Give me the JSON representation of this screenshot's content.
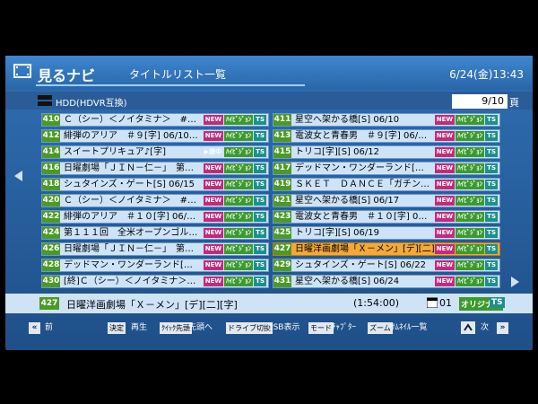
{
  "header": {
    "app_name": "見るナビ",
    "screen_title": "タイトルリスト一覧",
    "datetime": "6/24(金)13:43"
  },
  "drive": {
    "label": "HDD(HDVR互換)",
    "page_current": "9/10",
    "page_unit": "頁"
  },
  "badges": {
    "new": "NEW",
    "hd": "ﾊｲﾋﾞｼﾞｮﾝ",
    "ts": "TS",
    "playing": "▶途中"
  },
  "items": [
    {
      "num": "410",
      "title": "Ｃ（シー）＜ノイタミナ＞　#…",
      "badges": [
        "new",
        "hd",
        "ts"
      ]
    },
    {
      "num": "411",
      "title": "星空へ架かる橋[S] 06/10",
      "badges": [
        "new",
        "hd",
        "ts"
      ]
    },
    {
      "num": "412",
      "title": "緋弾のアリア　＃９[字] 06/10…",
      "badges": [
        "new",
        "hd",
        "ts"
      ]
    },
    {
      "num": "413",
      "title": "電波女と青春男　＃９[字] 06/…",
      "badges": [
        "new",
        "hd",
        "ts"
      ]
    },
    {
      "num": "414",
      "title": "スイートプリキュア♪[字]",
      "badges": [
        "playing",
        "hd",
        "ts"
      ]
    },
    {
      "num": "415",
      "title": "トリコ[字][S] 06/12",
      "badges": [
        "new",
        "hd",
        "ts"
      ]
    },
    {
      "num": "416",
      "title": "日曜劇場「ＪＩＮ－仁－」　第…",
      "badges": [
        "new",
        "hd",
        "ts"
      ]
    },
    {
      "num": "417",
      "title": "デッドマン・ワンダーランド[…",
      "badges": [
        "new",
        "hd",
        "ts"
      ]
    },
    {
      "num": "418",
      "title": "シュタインズ・ゲート[S] 06/15",
      "badges": [
        "new",
        "hd",
        "ts"
      ]
    },
    {
      "num": "419",
      "title": "ＳＫＥＴ　ＤＡＮＣＥ「ガチン…",
      "badges": [
        "new",
        "hd",
        "ts"
      ]
    },
    {
      "num": "420",
      "title": "Ｃ（シー）＜ノイタミナ＞　#…",
      "badges": [
        "new",
        "hd",
        "ts"
      ]
    },
    {
      "num": "421",
      "title": "星空へ架かる橋[S] 06/17",
      "badges": [
        "new",
        "hd",
        "ts"
      ]
    },
    {
      "num": "422",
      "title": "緋弾のアリア　＃１０[字] 06/…",
      "badges": [
        "new",
        "hd",
        "ts"
      ]
    },
    {
      "num": "423",
      "title": "電波女と青春男　＃１０[字] 0…",
      "badges": [
        "new",
        "hd",
        "ts"
      ]
    },
    {
      "num": "424",
      "title": "第１１１回　全米オープンゴル…",
      "badges": [
        "new",
        "hd",
        "ts"
      ]
    },
    {
      "num": "425",
      "title": "トリコ[字][S] 06/19",
      "badges": [
        "new",
        "hd",
        "ts"
      ]
    },
    {
      "num": "426",
      "title": "日曜劇場「ＪＩＮ－仁－」　第…",
      "badges": [
        "new",
        "hd",
        "ts"
      ]
    },
    {
      "num": "427",
      "title": "日曜洋画劇場「Ｘ－メン」[デ][二]…",
      "badges": [
        "new",
        "hd",
        "ts"
      ],
      "selected": true
    },
    {
      "num": "428",
      "title": "デッドマン・ワンダーランド[…",
      "badges": [
        "new",
        "hd",
        "ts"
      ]
    },
    {
      "num": "429",
      "title": "シュタインズ・ゲート[S] 06/22",
      "badges": [
        "new",
        "hd",
        "ts"
      ]
    },
    {
      "num": "430",
      "title": "[終]Ｃ（シー）＜ノイタミナ＞…",
      "badges": [
        "new",
        "hd",
        "ts"
      ]
    },
    {
      "num": "431",
      "title": "星空へ架かる橋[S] 06/24",
      "badges": [
        "new",
        "hd",
        "ts"
      ]
    }
  ],
  "info": {
    "num": "427",
    "title": "日曜洋画劇場「Ｘ－メン」[デ][二][字]",
    "duration": "(1:54:00)",
    "count": "01",
    "original": "オリジナル",
    "ts": "TS"
  },
  "help": {
    "prev": "前",
    "decide_key": "決定",
    "decide_label": "再生",
    "jump_key": "ｸｲｯｸ先頭",
    "jump_label": "先頭へ",
    "drive_key": "ドライブ切換",
    "drive_label": "USB表示",
    "mode_key": "モード",
    "mode_label": "ﾁｬﾌﾟﾀｰ",
    "zoom_key": "ズーム",
    "zoom_label": "ｻﾑﾈｲﾙ一覧",
    "next": "次"
  }
}
